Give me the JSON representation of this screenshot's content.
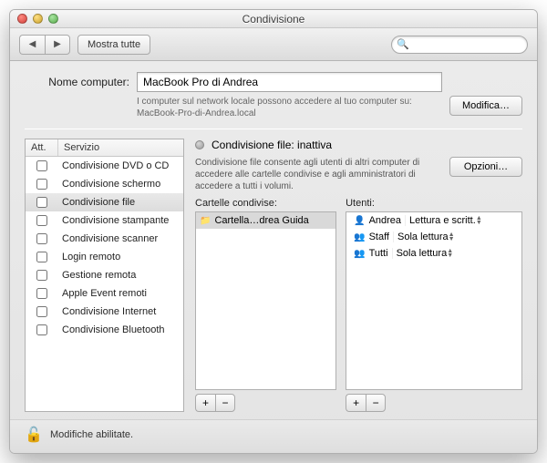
{
  "window": {
    "title": "Condivisione"
  },
  "toolbar": {
    "show_all": "Mostra tutte",
    "search_placeholder": ""
  },
  "computer": {
    "label": "Nome computer:",
    "value": "MacBook Pro di Andrea",
    "hint_line1": "I computer sul network locale possono accedere al tuo computer su:",
    "hint_line2": "MacBook-Pro-di-Andrea.local",
    "edit_btn": "Modifica…"
  },
  "services": {
    "header_on": "Att.",
    "header_service": "Servizio",
    "items": [
      {
        "label": "Condivisione DVD o CD",
        "on": false,
        "selected": false
      },
      {
        "label": "Condivisione schermo",
        "on": false,
        "selected": false
      },
      {
        "label": "Condivisione file",
        "on": false,
        "selected": true
      },
      {
        "label": "Condivisione stampante",
        "on": false,
        "selected": false
      },
      {
        "label": "Condivisione scanner",
        "on": false,
        "selected": false
      },
      {
        "label": "Login remoto",
        "on": false,
        "selected": false
      },
      {
        "label": "Gestione remota",
        "on": false,
        "selected": false
      },
      {
        "label": "Apple Event remoti",
        "on": false,
        "selected": false
      },
      {
        "label": "Condivisione Internet",
        "on": false,
        "selected": false
      },
      {
        "label": "Condivisione Bluetooth",
        "on": false,
        "selected": false
      }
    ]
  },
  "detail": {
    "status": "Condivisione file: inattiva",
    "description": "Condivisione file consente agli utenti di altri computer di accedere alle cartelle condivise e agli amministratori di accedere a tutti i volumi.",
    "options_btn": "Opzioni…",
    "folders_label": "Cartelle condivise:",
    "users_label": "Utenti:",
    "folders": [
      {
        "label": "Cartella…drea Guida",
        "selected": true
      }
    ],
    "users": [
      {
        "name": "Andrea",
        "icon": "single",
        "perm": "Lettura e scritt."
      },
      {
        "name": "Staff",
        "icon": "group",
        "perm": "Sola lettura"
      },
      {
        "name": "Tutti",
        "icon": "group",
        "perm": "Sola lettura"
      }
    ],
    "plus": "+",
    "minus": "−"
  },
  "footer": {
    "lock_text": "Modifiche abilitate."
  }
}
